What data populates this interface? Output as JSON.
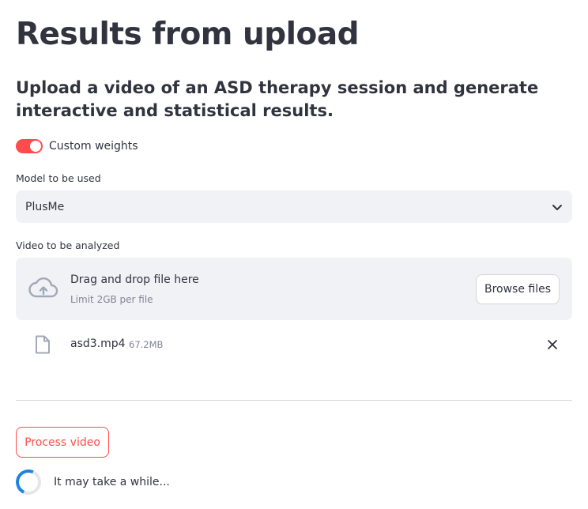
{
  "header": {
    "title": "Results from upload",
    "subtitle": "Upload a video of an ASD therapy session and generate interactive and statistical results."
  },
  "custom_weights": {
    "label": "Custom weights",
    "enabled": true
  },
  "model_select": {
    "label": "Model to be used",
    "value": "PlusMe"
  },
  "uploader": {
    "label": "Video to be analyzed",
    "drop_text": "Drag and drop file here",
    "limit_text": "Limit 2GB per file",
    "browse_label": "Browse files",
    "file": {
      "name": "asd3.mp4",
      "size": "67.2MB"
    }
  },
  "process_button": {
    "label": "Process video"
  },
  "status": {
    "text": "It may take a while..."
  },
  "colors": {
    "accent": "#ff4b4b",
    "spinner": "#1c83e1",
    "field_bg": "#f0f2f6",
    "text": "#31333f",
    "muted": "#808495"
  },
  "icons": {
    "upload": "cloud-upload-icon",
    "file": "file-icon",
    "remove": "close-icon",
    "dropdown": "chevron-down-icon"
  }
}
